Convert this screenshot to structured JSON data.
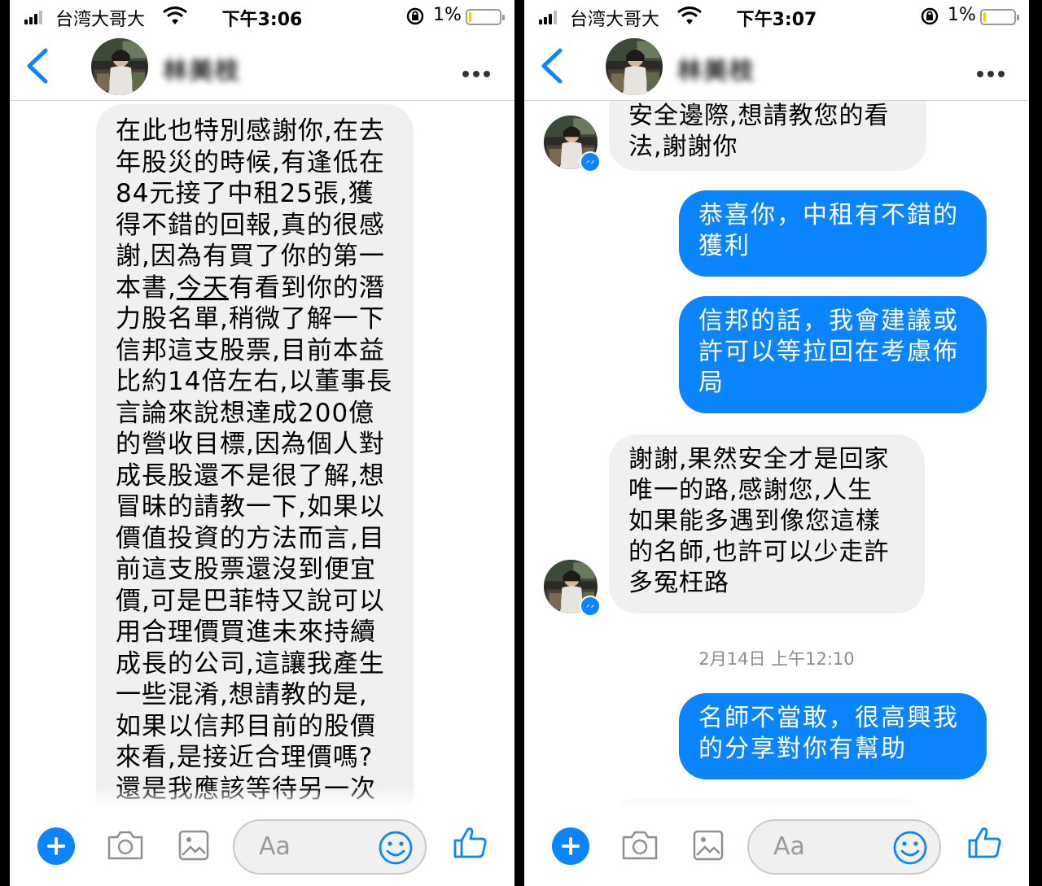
{
  "left": {
    "status": {
      "carrier": "台湾大哥大",
      "time": "下午3:06",
      "battery": "1%"
    },
    "contact": {
      "name": "林美枝"
    },
    "long_message_lines": [
      "在此也特別感謝你,在去",
      "年股災的時候,有逢低在",
      "84元接了中租25張,獲",
      "得不錯的回報,真的很感",
      "謝,因為有買了你的第一",
      {
        "before": "本書,",
        "underlined": "今天",
        "after": "有看到你的潛"
      },
      "力股名單,稍微了解一下",
      "信邦這支股票,目前本益",
      "比約14倍左右,以董事長",
      "言論來說想達成200億",
      "的營收目標,因為個人對",
      "成長股還不是很了解,想",
      "冒昧的請教一下,如果以",
      "價值投資的方法而言,目",
      "前這支股票還沒到便宜",
      "價,可是巴菲特又說可以",
      "用合理價買進未來持續",
      "成長的公司,這讓我產生",
      "一些混淆,想請教的是,",
      "如果以信邦目前的股價",
      "來看,是接近合理價嗎?",
      "還是我應該等待另一次"
    ],
    "composer": {
      "placeholder": "Aa"
    }
  },
  "right": {
    "status": {
      "carrier": "台湾大哥大",
      "time": "下午3:07",
      "battery": "1%"
    },
    "contact": {
      "name": "林美枝"
    },
    "messages": {
      "in_1": [
        "安全邊際,想請教您的看",
        "法,謝謝你"
      ],
      "out_1": [
        "恭喜你，中租有不錯的",
        "獲利"
      ],
      "out_2": [
        "信邦的話，我會建議或",
        "許可以等拉回在考慮佈",
        "局"
      ],
      "in_2": [
        "謝謝,果然安全才是回家",
        "唯一的路,感謝您,人生",
        "如果能多遇到像您這樣",
        "的名師,也許可以少走許",
        "多冤枉路"
      ],
      "timestamp": "2月14日 上午12:10",
      "out_3": [
        "名師不當敢，很高興我",
        "的分享對你有幫助"
      ]
    },
    "composer": {
      "placeholder": "Aa"
    }
  },
  "colors": {
    "accent": "#0a84ff",
    "incoming_bubble": "#f1f0f0",
    "timestamp": "#8a8d91"
  },
  "icons": [
    "signal-icon",
    "wifi-icon",
    "rotation-lock-icon",
    "battery-icon",
    "back-chevron-icon",
    "more-icon",
    "plus-icon",
    "camera-icon",
    "gallery-icon",
    "smile-icon",
    "thumbs-up-icon",
    "messenger-badge-icon"
  ]
}
